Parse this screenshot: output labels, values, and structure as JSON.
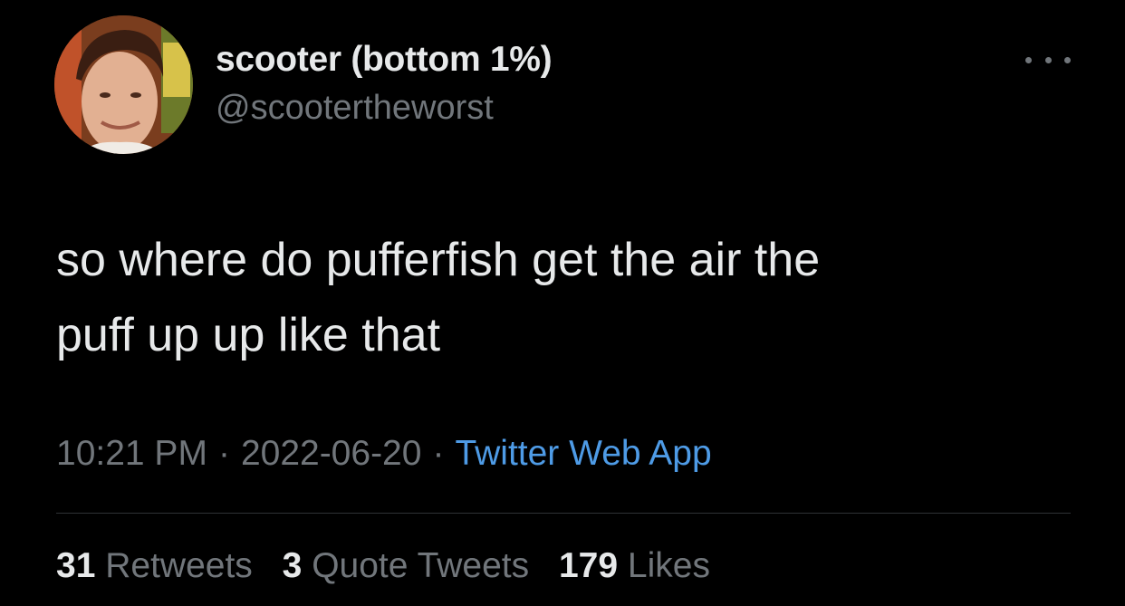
{
  "user": {
    "display_name": "scooter (bottom 1%)",
    "handle": "@scootertheworst",
    "avatar_icon": "profile-photo"
  },
  "menu": {
    "icon": "more-dots-icon"
  },
  "tweet": {
    "lines": [
      "so where do pufferfish get the air the",
      "puff up up like that"
    ],
    "time": "10:21 PM",
    "date": "2022-06-20",
    "separator": "·",
    "source": "Twitter Web App"
  },
  "stats": {
    "retweets_count": "31",
    "retweets_label": "Retweets",
    "quotes_count": "3",
    "quotes_label": "Quote Tweets",
    "likes_count": "179",
    "likes_label": "Likes"
  },
  "colors": {
    "background": "#000000",
    "primary_text": "#e7e9ea",
    "secondary_text": "#71767b",
    "link": "#4e9be6",
    "divider": "#2f3336"
  }
}
